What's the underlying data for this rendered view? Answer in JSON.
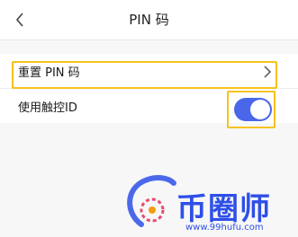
{
  "header": {
    "title": "PIN 码"
  },
  "rows": [
    {
      "label": "重置 PIN 码"
    },
    {
      "label": "使用触控ID"
    }
  ],
  "touch_id_toggle": {
    "on": true
  },
  "watermark": {
    "brand": "币圈师",
    "url": "www.99hufu.com"
  },
  "colors": {
    "toggle_on": "#4a67e9",
    "highlight": "#f6c21c",
    "watermark": "#2e4fe8"
  },
  "icons": {
    "back": "chevron-left-icon",
    "row_arrow": "chevron-right-icon"
  }
}
